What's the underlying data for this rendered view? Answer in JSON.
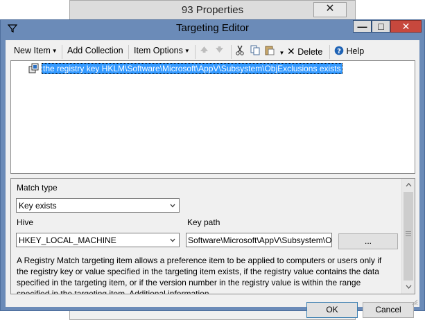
{
  "background_window": {
    "title": "93 Properties",
    "close_glyph": "✕"
  },
  "dialog": {
    "title": "Targeting Editor",
    "title_icon": "filter-icon",
    "min_glyph": "—",
    "max_glyph": "□",
    "close_glyph": "✕"
  },
  "toolbar": {
    "new_item": "New Item",
    "add_collection": "Add Collection",
    "item_options": "Item Options",
    "move_up_icon": "arrow-up-icon",
    "move_down_icon": "arrow-down-icon",
    "cut_icon": "scissors-icon",
    "copy_icon": "copy-icon",
    "paste_icon": "paste-icon",
    "delete": "Delete",
    "help": "Help"
  },
  "tree": {
    "items": [
      {
        "label": "the registry key HKLM\\Software\\Microsoft\\AppV\\Subsystem\\ObjExclusions exists",
        "icon": "registry-icon",
        "selected": true
      }
    ]
  },
  "properties": {
    "match_type_label": "Match type",
    "match_type_value": "Key exists",
    "hive_label": "Hive",
    "hive_value": "HKEY_LOCAL_MACHINE",
    "key_path_label": "Key path",
    "key_path_value": "Software\\Microsoft\\AppV\\Subsystem\\ObjExclusions",
    "browse_label": "...",
    "description": "A Registry Match targeting item allows a preference item to be applied to computers or users only if the registry key or value specified in the targeting item exists, if the registry value contains the data specified in the targeting item, or if the version number in the registry value is within the range specified in the targeting item. Additional information..."
  },
  "footer": {
    "ok": "OK",
    "cancel": "Cancel"
  },
  "colors": {
    "accent": "#6b8bb8",
    "selection": "#3399ff",
    "close": "#c7483d"
  }
}
